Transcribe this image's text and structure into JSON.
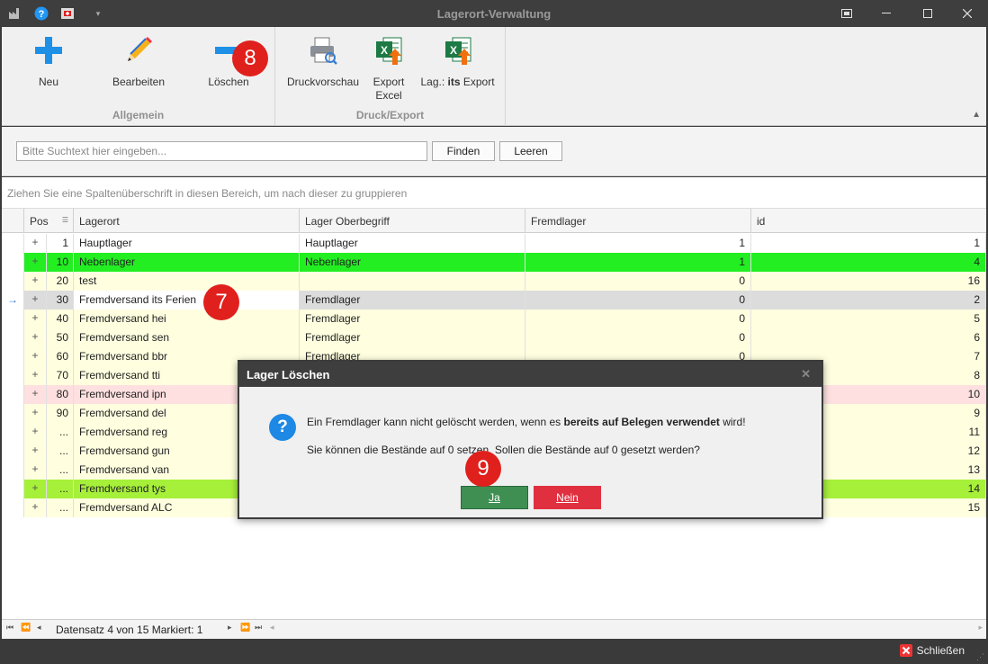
{
  "window": {
    "title": "Lagerort-Verwaltung"
  },
  "ribbon": {
    "buttons": {
      "neu": "Neu",
      "bearbeiten": "Bearbeiten",
      "loeschen": "Löschen",
      "druckvorschau": "Druckvorschau",
      "export_excel_line1": "Export",
      "export_excel_line2": "Excel",
      "lag_prefix": "Lag.: ",
      "lag_bold": "its",
      "lag_suffix": " Export"
    },
    "groups": {
      "allgemein": "Allgemein",
      "druck": "Druck/Export"
    }
  },
  "search": {
    "placeholder": "Bitte Suchtext hier eingeben...",
    "find_label": "Finden",
    "clear_label": "Leeren"
  },
  "group_hint": "Ziehen Sie eine Spaltenüberschrift in diesen Bereich, um nach dieser zu gruppieren",
  "grid": {
    "columns": {
      "pos": "Pos",
      "lagerort": "Lagerort",
      "oberbegriff": "Lager Oberbegriff",
      "fremdlager": "Fremdlager",
      "id": "id"
    },
    "rows": [
      {
        "pos": "1",
        "lagerort": "Hauptlager",
        "oberbegriff": "Hauptlager",
        "fremdlager": "1",
        "id": "1",
        "bg": "#ffffff"
      },
      {
        "pos": "10",
        "lagerort": "Nebenlager",
        "oberbegriff": "Nebenlager",
        "fremdlager": "1",
        "id": "4",
        "bg": "#22ee22"
      },
      {
        "pos": "20",
        "lagerort": "test",
        "oberbegriff": "",
        "fremdlager": "0",
        "id": "16",
        "bg": "#ffffe0"
      },
      {
        "pos": "30",
        "lagerort": "Fremdversand its Ferien",
        "oberbegriff": "Fremdlager",
        "fremdlager": "0",
        "id": "2",
        "bg": "#dcdcdc"
      },
      {
        "pos": "40",
        "lagerort": "Fremdversand hei",
        "oberbegriff": "Fremdlager",
        "fremdlager": "0",
        "id": "5",
        "bg": "#ffffe0"
      },
      {
        "pos": "50",
        "lagerort": "Fremdversand sen",
        "oberbegriff": "Fremdlager",
        "fremdlager": "0",
        "id": "6",
        "bg": "#ffffe0"
      },
      {
        "pos": "60",
        "lagerort": "Fremdversand bbr",
        "oberbegriff": "Fremdlager",
        "fremdlager": "0",
        "id": "7",
        "bg": "#ffffe0"
      },
      {
        "pos": "70",
        "lagerort": "Fremdversand tti",
        "oberbegriff": "",
        "fremdlager": "",
        "id": "8",
        "bg": "#ffffe0"
      },
      {
        "pos": "80",
        "lagerort": "Fremdversand ipn",
        "oberbegriff": "",
        "fremdlager": "",
        "id": "10",
        "bg": "#ffe0e0"
      },
      {
        "pos": "90",
        "lagerort": "Fremdversand del",
        "oberbegriff": "",
        "fremdlager": "",
        "id": "9",
        "bg": "#ffffe0"
      },
      {
        "pos": "...",
        "lagerort": "Fremdversand reg",
        "oberbegriff": "",
        "fremdlager": "",
        "id": "11",
        "bg": "#ffffe0"
      },
      {
        "pos": "...",
        "lagerort": "Fremdversand gun",
        "oberbegriff": "",
        "fremdlager": "",
        "id": "12",
        "bg": "#ffffe0"
      },
      {
        "pos": "...",
        "lagerort": "Fremdversand van",
        "oberbegriff": "",
        "fremdlager": "",
        "id": "13",
        "bg": "#ffffe0"
      },
      {
        "pos": "...",
        "lagerort": "Fremdversand tys",
        "oberbegriff": "",
        "fremdlager": "",
        "id": "14",
        "bg": "#a6f03a"
      },
      {
        "pos": "...",
        "lagerort": "Fremdversand ALC",
        "oberbegriff": "",
        "fremdlager": "",
        "id": "15",
        "bg": "#ffffe0"
      }
    ],
    "row_expander_glyph": "+"
  },
  "navigator": {
    "record_text": "Datensatz 4 von 15 Markiert: 1"
  },
  "status": {
    "close_label": "Schließen"
  },
  "dialog": {
    "title": "Lager Löschen",
    "line1_prefix": "Ein Fremdlager kann nicht gelöscht werden, wenn es ",
    "line1_bold": "bereits auf Belegen verwendet",
    "line1_suffix": " wird!",
    "line2": "Sie können die Bestände auf 0 setzen. Sollen die Bestände auf 0 gesetzt werden?",
    "yes_label": "Ja",
    "no_label": "Nein",
    "yes_color": "#3f8f52",
    "no_color": "#e03040"
  },
  "markers": {
    "m7": "7",
    "m8": "8",
    "m9": "9"
  }
}
